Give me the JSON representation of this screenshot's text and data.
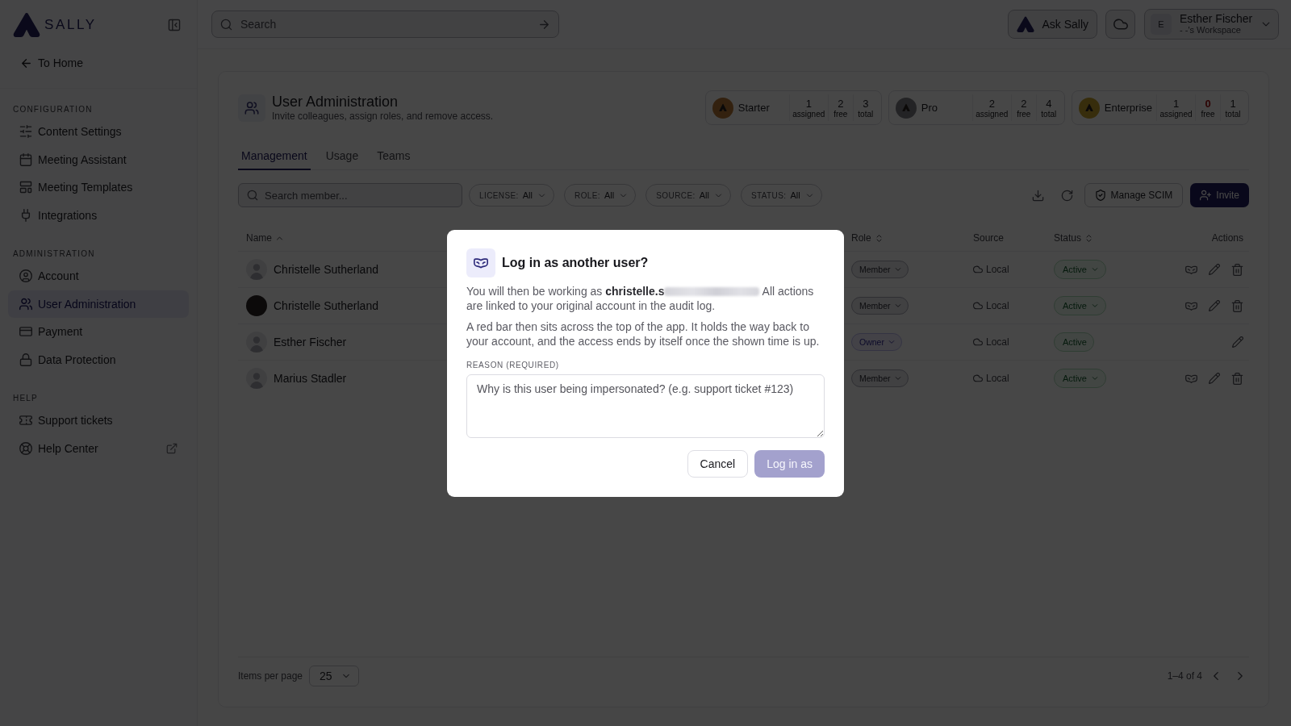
{
  "sidebar": {
    "logo": "SALLY",
    "back_link": "To Home",
    "sections": [
      {
        "title": "CONFIGURATION",
        "items": [
          {
            "label": "Content Settings",
            "selected": false,
            "external": false
          },
          {
            "label": "Meeting Assistant",
            "selected": false,
            "external": false
          },
          {
            "label": "Meeting Templates",
            "selected": false,
            "external": false
          },
          {
            "label": "Integrations",
            "selected": false,
            "external": false
          }
        ]
      },
      {
        "title": "ADMINISTRATION",
        "items": [
          {
            "label": "Account",
            "selected": false,
            "external": false
          },
          {
            "label": "User Administration",
            "selected": true,
            "external": false
          },
          {
            "label": "Payment",
            "selected": false,
            "external": false
          },
          {
            "label": "Data Protection",
            "selected": false,
            "external": false
          }
        ]
      },
      {
        "title": "HELP",
        "items": [
          {
            "label": "Support tickets",
            "selected": false,
            "external": false
          },
          {
            "label": "Help Center",
            "selected": false,
            "external": true
          }
        ]
      }
    ]
  },
  "topbar": {
    "search": {
      "placeholder": "Search"
    },
    "ask_button": "Ask Sally",
    "user": {
      "initial": "E",
      "name": "Esther Fischer",
      "workspace": "- -'s Workspace"
    }
  },
  "header": {
    "title": "User Administration",
    "subtitle": "Invite colleagues, assign roles, and remove access."
  },
  "licenses": [
    {
      "name": "Starter",
      "color": "#33210f",
      "stats": [
        {
          "value": "1",
          "label": "assigned",
          "alert": false
        },
        {
          "value": "2",
          "label": "free",
          "alert": false
        },
        {
          "value": "3",
          "label": "total",
          "alert": false
        }
      ]
    },
    {
      "name": "Pro",
      "color": "#232325",
      "stats": [
        {
          "value": "2",
          "label": "assigned",
          "alert": false
        },
        {
          "value": "2",
          "label": "free",
          "alert": false
        },
        {
          "value": "4",
          "label": "total",
          "alert": false
        }
      ]
    },
    {
      "name": "Enterprise",
      "color": "#372d0c",
      "stats": [
        {
          "value": "1",
          "label": "assigned",
          "alert": false
        },
        {
          "value": "0",
          "label": "free",
          "alert": true
        },
        {
          "value": "1",
          "label": "total",
          "alert": false
        }
      ]
    }
  ],
  "tabs": [
    {
      "label": "Management",
      "selected": true
    },
    {
      "label": "Usage",
      "selected": false
    },
    {
      "label": "Teams",
      "selected": false
    }
  ],
  "filters": {
    "search": {
      "placeholder": "Search member..."
    },
    "chips": [
      {
        "label": "LICENSE:",
        "value": "All"
      },
      {
        "label": "ROLE:",
        "value": "All"
      },
      {
        "label": "SOURCE:",
        "value": "All"
      },
      {
        "label": "STATUS:",
        "value": "All"
      }
    ]
  },
  "toolbar": {
    "scim_button": "Manage SCIM",
    "invite_button": "Invite"
  },
  "table": {
    "columns": [
      {
        "label": "Name",
        "kind": "ascending"
      },
      {
        "label": "Role",
        "kind": "sortable"
      },
      {
        "label": "Source",
        "kind": "plain"
      },
      {
        "label": "Status",
        "kind": "sortable"
      },
      {
        "label": "Actions",
        "kind": "plain"
      }
    ],
    "rows": [
      {
        "name": "Christelle Sutherland",
        "avatar": {
          "kind": "default"
        },
        "role": {
          "label": "Member",
          "kind": "member"
        },
        "source": "Local",
        "status": "Active",
        "status_editable": true,
        "can_impersonate": true,
        "can_delete": true
      },
      {
        "name": "Christelle Sutherland",
        "avatar": {
          "kind": "photo"
        },
        "role": {
          "label": "Member",
          "kind": "member"
        },
        "source": "Local",
        "status": "Active",
        "status_editable": true,
        "can_impersonate": true,
        "can_delete": true
      },
      {
        "name": "Esther Fischer",
        "avatar": {
          "kind": "default"
        },
        "role": {
          "label": "Owner",
          "kind": "owner"
        },
        "source": "Local",
        "status": "Active",
        "status_editable": false,
        "can_impersonate": false,
        "can_delete": false
      },
      {
        "name": "Marius Stadler",
        "avatar": {
          "kind": "default"
        },
        "role": {
          "label": "Member",
          "kind": "member"
        },
        "source": "Local",
        "status": "Active",
        "status_editable": true,
        "can_impersonate": true,
        "can_delete": true
      }
    ]
  },
  "pagination": {
    "label": "Items per page",
    "page_size": "25",
    "range": "1–4 of 4",
    "prev_disabled": true,
    "next_disabled": true
  },
  "dialog": {
    "title": "Log in as another user?",
    "description": {
      "lead": "You will then be working as **christelle.s**",
      "redacted": true,
      "tail": "All actions are linked to your original account in the audit log."
    },
    "note": "A red bar then sits across the top of the app. It holds the way back to your account, and the access ends by itself once the shown time is up.",
    "reason": {
      "label": "REASON (REQUIRED)",
      "placeholder": "Why is this user being impersonated? (e.g. support ticket #123)"
    },
    "buttons": [
      {
        "label": "Cancel",
        "kind": "secondary",
        "disabled": false
      },
      {
        "label": "Log in as",
        "kind": "primary",
        "disabled": true
      }
    ]
  }
}
